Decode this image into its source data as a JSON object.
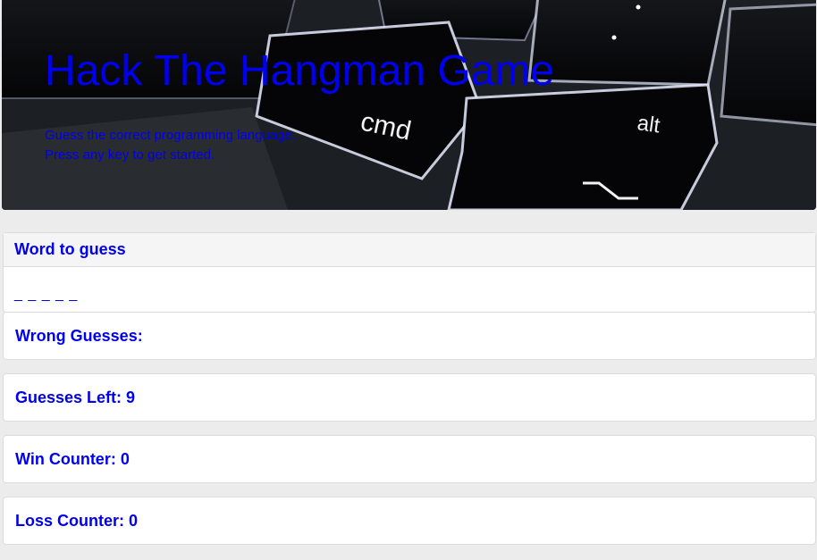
{
  "header": {
    "title": "Hack The Hangman Game",
    "subtitle_line1": "Guess the correct programming language.",
    "subtitle_line2": "Press any key to get started."
  },
  "word_panel": {
    "heading": "Word to guess",
    "word": "_ _ _ _ _"
  },
  "stats": {
    "wrong_guesses": "Wrong Guesses:",
    "guesses_left": "Guesses Left: 9",
    "win_counter": "Win Counter: 0",
    "loss_counter": "Loss Counter: 0"
  },
  "keyboard_keys": {
    "cmd": "cmd",
    "alt": "alt"
  },
  "colors": {
    "text": "#0000ee",
    "panel_border": "#dcdcdc",
    "heading_bg": "#f5f5f5"
  }
}
